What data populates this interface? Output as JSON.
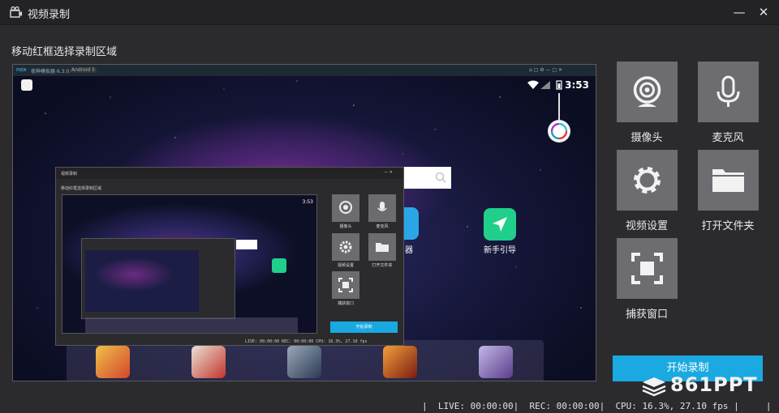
{
  "window": {
    "title": "视频录制",
    "minimize_glyph": "—",
    "close_glyph": "✕"
  },
  "hint": "移动红框选择录制区域",
  "emulator": {
    "brand": "nox",
    "app_name": "夜神模拟器 6.3.0.0",
    "android_badge": "Android 5",
    "time": "3:53",
    "apps": [
      {
        "label": "新手引导"
      },
      {
        "label": "器"
      }
    ]
  },
  "nested": {
    "title": "视频录制",
    "hint": "移动红框选择录制区域",
    "time": "3:53",
    "tiles": [
      {
        "label": "摄像头"
      },
      {
        "label": "麦克风"
      },
      {
        "label": "视频设置"
      },
      {
        "label": "打开文件夹"
      },
      {
        "label": "捕获窗口"
      }
    ],
    "start_label": "开始录制",
    "status": "LIVE: 00:00:00  REC: 00:00:00  CPU: 16.3%, 27.10 fps"
  },
  "tiles": [
    {
      "name": "camera",
      "label": "摄像头",
      "icon": "webcam-icon"
    },
    {
      "name": "microphone",
      "label": "麦克风",
      "icon": "microphone-icon"
    },
    {
      "name": "video-settings",
      "label": "视频设置",
      "icon": "gear-icon"
    },
    {
      "name": "open-folder",
      "label": "打开文件夹",
      "icon": "folder-icon"
    },
    {
      "name": "capture-window",
      "label": "捕获窗口",
      "icon": "capture-window-icon"
    }
  ],
  "start_button": "开始录制",
  "status": {
    "live": "LIVE: 00:00:00",
    "rec": "REC: 00:00:00",
    "cpu": "CPU: 16.3%, 27.10 fps"
  },
  "watermark": "861PPT",
  "colors": {
    "accent": "#1aa9e1",
    "tile_bg": "#6d6d71",
    "window_bg": "#2b2b2e"
  }
}
